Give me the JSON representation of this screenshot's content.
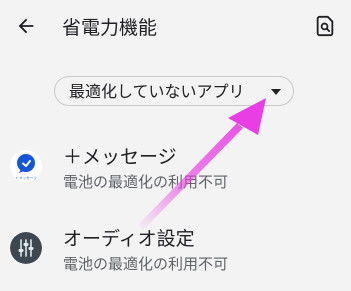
{
  "appbar": {
    "title": "省電力機能",
    "back_icon": "arrow-back-icon",
    "search_icon": "search-icon"
  },
  "filter": {
    "selected": "最適化していないアプリ",
    "dropdown_icon": "dropdown-caret-icon"
  },
  "apps": [
    {
      "name": "＋メッセージ",
      "status": "電池の最適化の利用不可",
      "icon": "plus-message-app-icon",
      "icon_caption": "+ メッセージ"
    },
    {
      "name": "オーディオ設定",
      "status": "電池の最適化の利用不可",
      "icon": "audio-settings-app-icon"
    }
  ],
  "colors": {
    "background": "#f3f3f3",
    "text_primary": "#202124",
    "text_secondary": "#5f6368",
    "annotation_arrow": "#e83ee3",
    "plus_message_blue": "#1556d6"
  }
}
